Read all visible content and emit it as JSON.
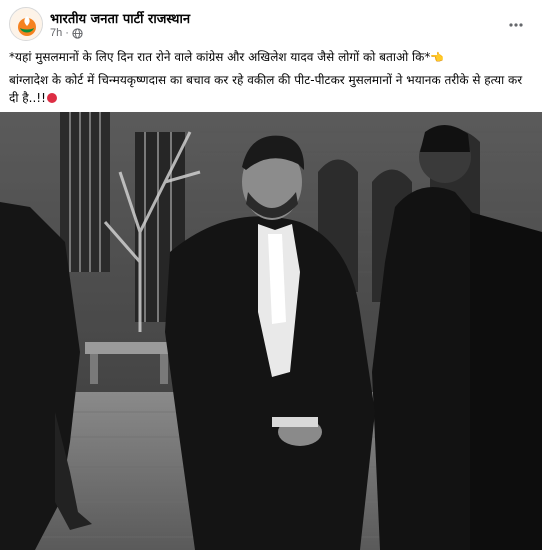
{
  "post": {
    "page_name": "भारतीय जनता पार्टी राजस्थान",
    "time": "7h",
    "privacy_icon": "globe-icon",
    "more_icon": "more-options-icon",
    "line1": "*यहां मुसलमानों के लिए दिन रात रोने वाले कांग्रेस और अखिलेश यादव जैसे लोगों को बताओ कि*",
    "line2": "बांग्लादेश के कोर्ट में चिन्मयकृष्णदास का बचाव कर रहे वकील की पीट-पीटकर मुसलमानों ने भयानक तरीके से हत्या कर दी है..!!"
  },
  "colors": {
    "text": "#050505",
    "meta": "#65676b",
    "red_dot": "#dd2e44",
    "avatar_saffron": "#f58220"
  }
}
